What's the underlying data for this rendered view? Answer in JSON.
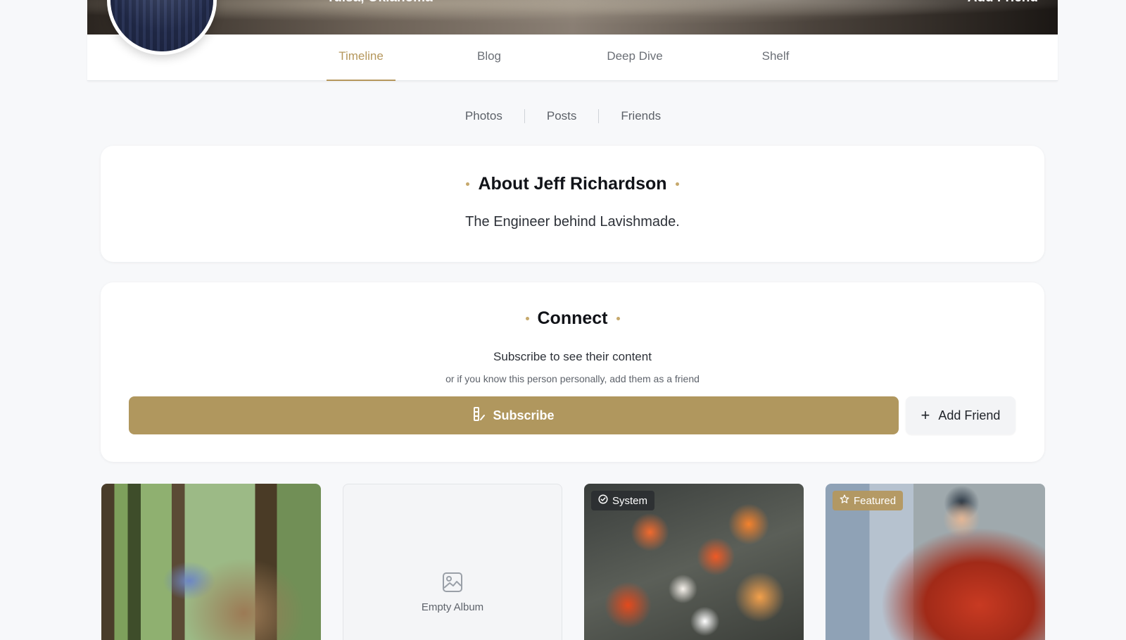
{
  "header": {
    "location": "Tulsa, Oklahoma",
    "add_friend_label": "Add Friend"
  },
  "tabs": [
    {
      "label": "Timeline",
      "active": true
    },
    {
      "label": "Blog",
      "active": false
    },
    {
      "label": "Deep Dive",
      "active": false
    },
    {
      "label": "Shelf",
      "active": false
    }
  ],
  "subnav": {
    "photos": "Photos",
    "posts": "Posts",
    "friends": "Friends"
  },
  "about": {
    "title": "About Jeff Richardson",
    "text": "The Engineer behind Lavishmade."
  },
  "connect": {
    "title": "Connect",
    "main": "Subscribe to see their content",
    "sub": "or if you know this person personally, add them as a friend",
    "subscribe_label": "Subscribe",
    "add_friend_label": "Add Friend"
  },
  "albums": [
    {
      "badge": ""
    },
    {
      "empty_label": "Empty Album"
    },
    {
      "badge": "System"
    },
    {
      "badge": "Featured"
    }
  ],
  "colors": {
    "accent": "#b0975e",
    "background": "#f7f8fa"
  }
}
